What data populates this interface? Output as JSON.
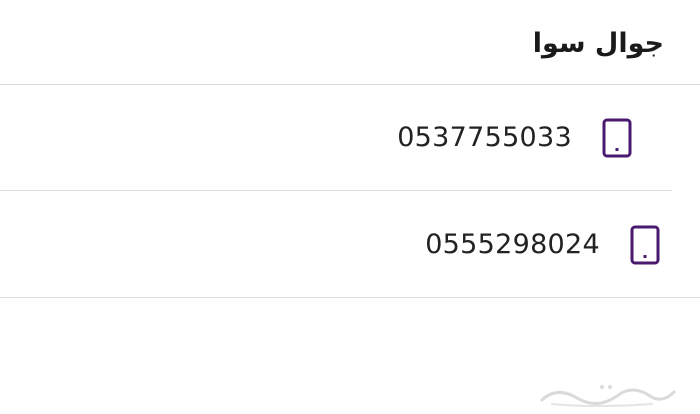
{
  "section": {
    "title": "جوال سوا"
  },
  "numbers": [
    {
      "value": "0537755033",
      "icon": "mobile-phone-icon"
    },
    {
      "value": "0555298024",
      "icon": "mobile-phone-icon"
    }
  ],
  "colors": {
    "icon_accent": "#4a1a6e",
    "divider": "#dcdcdc",
    "text": "#222222"
  },
  "watermark": {
    "text": "حراج"
  }
}
